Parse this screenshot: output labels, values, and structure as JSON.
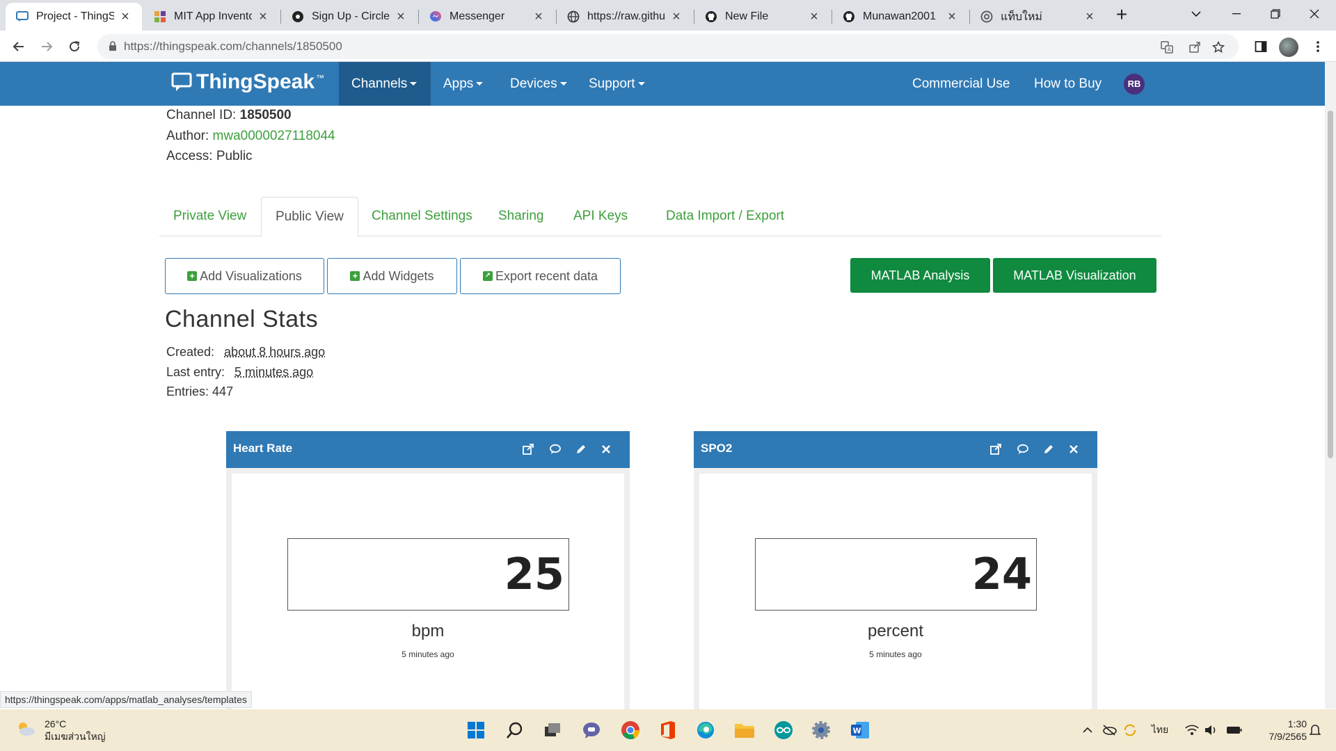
{
  "browser": {
    "tabs": [
      {
        "title": "Project - ThingSp",
        "active": true
      },
      {
        "title": "MIT App Inventor"
      },
      {
        "title": "Sign Up - CircleCI"
      },
      {
        "title": "Messenger"
      },
      {
        "title": "https://raw.githu"
      },
      {
        "title": "New File"
      },
      {
        "title": "Munawan2001"
      },
      {
        "title": "แท็บใหม่"
      }
    ],
    "url": "https://thingspeak.com/channels/1850500"
  },
  "nav": {
    "logo": "ThingSpeak",
    "logo_tm": "™",
    "items": [
      "Channels",
      "Apps",
      "Devices",
      "Support"
    ],
    "right": [
      "Commercial Use",
      "How to Buy"
    ],
    "avatar": "RB"
  },
  "channel": {
    "id_label": "Channel ID:",
    "id": "1850500",
    "author_label": "Author:",
    "author": "mwa0000027118044",
    "access_label": "Access:",
    "access": "Public"
  },
  "page_tabs": [
    "Private View",
    "Public View",
    "Channel Settings",
    "Sharing",
    "API Keys",
    "Data Import / Export"
  ],
  "actions": {
    "add_viz": "Add Visualizations",
    "add_widgets": "Add Widgets",
    "export": "Export recent data",
    "matlab_analysis": "MATLAB Analysis",
    "matlab_viz": "MATLAB Visualization"
  },
  "stats": {
    "title": "Channel Stats",
    "created_label": "Created:",
    "created": "about 8 hours ago",
    "last_label": "Last entry:",
    "last": "5 minutes ago",
    "entries_label": "Entries:",
    "entries": "447"
  },
  "widgets": [
    {
      "title": "Heart Rate",
      "value": "25",
      "unit": "bpm",
      "updated": "5 minutes ago"
    },
    {
      "title": "SPO2",
      "value": "24",
      "unit": "percent",
      "updated": "5 minutes ago"
    }
  ],
  "status_url": "https://thingspeak.com/apps/matlab_analyses/templates",
  "taskbar": {
    "temp": "26°C",
    "weather": "มีเมฆส่วนใหญ่",
    "lang": "ไทย",
    "time": "1:30",
    "date": "7/9/2565"
  },
  "colors": {
    "nav": "#2f79b5",
    "link": "#3c9f3c",
    "matlab_button": "#0f8a3f"
  }
}
